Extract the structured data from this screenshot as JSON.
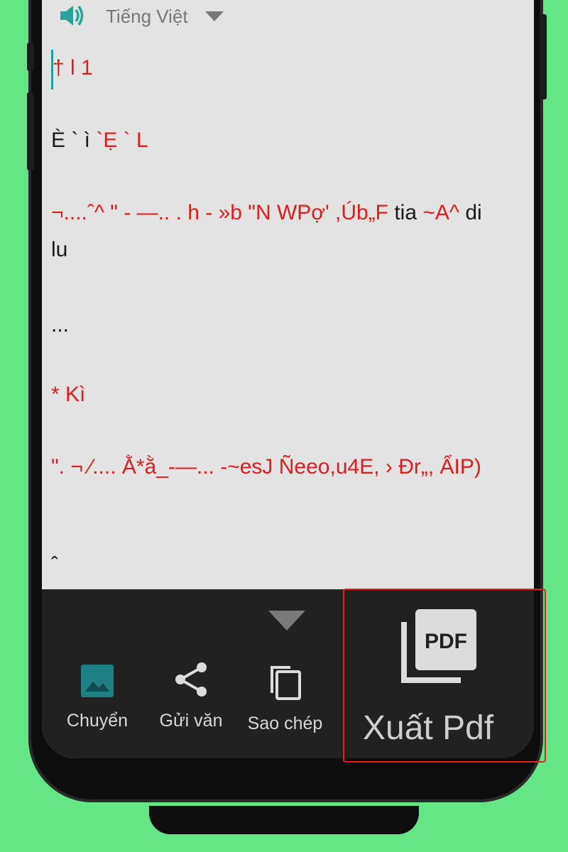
{
  "toolbar": {
    "speaker_icon": "speaker-icon",
    "language": "Tiếng Việt",
    "dropdown_icon": "triangle-down-icon"
  },
  "document": {
    "lines": [
      {
        "text": "† l 1",
        "color": "red"
      },
      {
        "text": "È ` ì ",
        "color": "black"
      },
      {
        "text": "`Ẹ ` L",
        "color": "red"
      },
      {
        "text": "¬....ˆ^ \" - —.. . h - »b \"N WPợ' ,Úb„F",
        "color": "red"
      },
      {
        "text": " tia ",
        "color": "black"
      },
      {
        "text": "~A^",
        "color": "red"
      },
      {
        "text": " di",
        "color": "black"
      },
      {
        "text": "lu",
        "color": "black"
      },
      {
        "text": "...",
        "color": "black"
      },
      {
        "text": "* Kì",
        "color": "red"
      },
      {
        "text": "\". ¬ ⁄.... Ằ*ằ_-—... -~esJ Ñeeo,u4E, › Đr„, ẨIP)",
        "color": "red"
      },
      {
        "text": "ˆ",
        "color": "black"
      }
    ]
  },
  "actions": [
    {
      "label": "Chuyển",
      "icon": "image-icon"
    },
    {
      "label": "Gửi văn",
      "icon": "share-icon"
    },
    {
      "label": "Sao chép",
      "icon": "copy-icon"
    }
  ],
  "export": {
    "label": "Xuất Pdf",
    "icon": "pdf-icon",
    "icon_text": "PDF"
  },
  "colors": {
    "background": "#63e683",
    "accent": "#1aa39a",
    "text_red": "#e01b1b",
    "panel": "#212121",
    "highlight": "#e02020"
  }
}
